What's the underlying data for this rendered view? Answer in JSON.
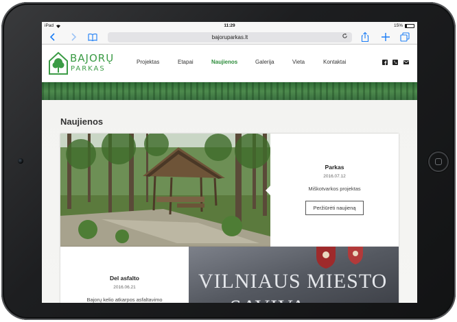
{
  "device": {
    "status": {
      "carrier": "iPad",
      "time": "11:29",
      "battery": "15%",
      "battery_level": 0.15
    }
  },
  "browser": {
    "url": "bajoruparkas.lt",
    "icons": {
      "back": "chevron-left-icon",
      "forward": "chevron-right-icon",
      "bookmarks": "book-icon",
      "reload": "reload-icon",
      "share": "share-icon",
      "new_tab": "plus-icon",
      "tabs": "tabs-icon"
    }
  },
  "site": {
    "logo": {
      "line1": "BAJORŲ",
      "line2": "PARKAS",
      "color": "#3b9b45"
    },
    "nav": [
      {
        "label": "Projektas",
        "active": false
      },
      {
        "label": "Etapai",
        "active": false
      },
      {
        "label": "Naujienos",
        "active": true
      },
      {
        "label": "Galerija",
        "active": false
      },
      {
        "label": "Vieta",
        "active": false
      },
      {
        "label": "Kontaktai",
        "active": false
      }
    ],
    "social_icons": [
      "facebook-icon",
      "phone-icon",
      "mail-icon"
    ],
    "accent_color": "#2c8b3a"
  },
  "page": {
    "title": "Naujienos",
    "news": [
      {
        "title": "Parkas",
        "date": "2016.07.12",
        "desc": "Miškotvarkos projektas",
        "button": "Peržiūrėti naujieną"
      },
      {
        "title": "Del asfalto",
        "date": "2016.06.21",
        "desc": "Bajorų kelio atkarpos asfaltavimo"
      }
    ],
    "sign_text": {
      "line1": "VILNIAUS MIESTO",
      "line2": "SAVIVA"
    }
  }
}
